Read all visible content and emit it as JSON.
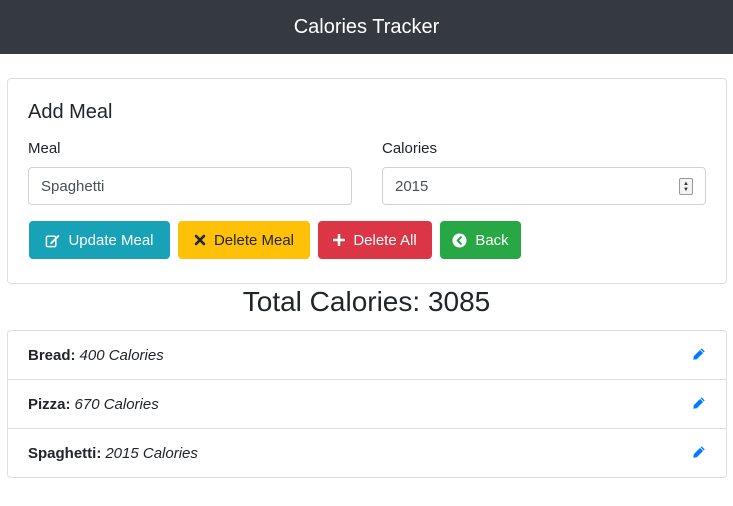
{
  "navbar": {
    "title": "Calories Tracker"
  },
  "form": {
    "title": "Add Meal",
    "meal_label": "Meal",
    "meal_value": "Spaghetti",
    "calories_label": "Calories",
    "calories_value": "2015"
  },
  "buttons": {
    "update": "Update Meal",
    "delete": "Delete Meal",
    "delete_all": "Delete All",
    "back": "Back"
  },
  "total": {
    "label": "Total Calories:",
    "value": "3085"
  },
  "items": [
    {
      "name": "Bread:",
      "calories": "400 Calories"
    },
    {
      "name": "Pizza:",
      "calories": "670 Calories"
    },
    {
      "name": "Spaghetti:",
      "calories": "2015 Calories"
    }
  ],
  "colors": {
    "navbar": "#343a40",
    "info": "#17a2b8",
    "warning": "#ffc107",
    "danger": "#dc3545",
    "success": "#28a745",
    "edit_icon": "#007bff"
  },
  "icons": {
    "update": "edit-icon",
    "delete": "close-icon",
    "delete_all": "plus-icon",
    "back": "chevron-left-circle-icon",
    "item_edit": "pencil-icon"
  }
}
